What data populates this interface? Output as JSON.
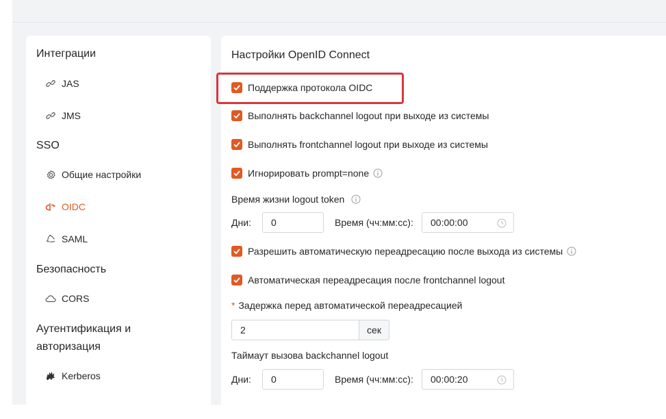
{
  "sidebar": {
    "groups": [
      {
        "title": "Интеграции",
        "items": [
          {
            "label": "JAS",
            "icon": "link-icon"
          },
          {
            "label": "JMS",
            "icon": "link-icon"
          }
        ]
      },
      {
        "title": "SSO",
        "items": [
          {
            "label": "Общие настройки",
            "icon": "gear-icon"
          },
          {
            "label": "OIDC",
            "icon": "openid-icon"
          },
          {
            "label": "SAML",
            "icon": "saml-icon"
          }
        ]
      },
      {
        "title": "Безопасность",
        "items": [
          {
            "label": "CORS",
            "icon": "cloud-icon"
          }
        ]
      },
      {
        "title": "Аутентификация и авторизация",
        "items": [
          {
            "label": "Kerberos",
            "icon": "kerberos-icon"
          }
        ]
      }
    ],
    "active_item": "OIDC"
  },
  "main": {
    "title": "Настройки OpenID Connect",
    "checkboxes": [
      {
        "label": "Поддержка протокола OIDC",
        "checked": true
      },
      {
        "label": "Выполнять backchannel logout при выходе из системы",
        "checked": true
      },
      {
        "label": "Выполнять frontchannel logout при выходе из системы",
        "checked": true
      },
      {
        "label": "Игнорировать prompt=none",
        "checked": true,
        "info": true
      },
      {
        "label": "Разрешить автоматическую переадресацию после выхода из системы",
        "checked": true,
        "info": true
      },
      {
        "label": "Автоматическая переадресация после frontchannel logout",
        "checked": true
      }
    ],
    "logout_token": {
      "title": "Время жизни logout token",
      "days_label": "Дни:",
      "days_value": "0",
      "time_label": "Время (чч:мм:сс):",
      "time_value": "00:00:00"
    },
    "redirect_delay": {
      "required_mark": "*",
      "title": "Задержка перед автоматической переадресацией",
      "value": "2",
      "unit": "сек"
    },
    "backchannel_timeout": {
      "title": "Таймаут вызова backchannel logout",
      "days_label": "Дни:",
      "days_value": "0",
      "time_label": "Время (чч:мм:сс):",
      "time_value": "00:00:20"
    }
  },
  "colors": {
    "accent": "#e05a22",
    "highlight": "#d9363e",
    "background": "#f2f3f5"
  }
}
